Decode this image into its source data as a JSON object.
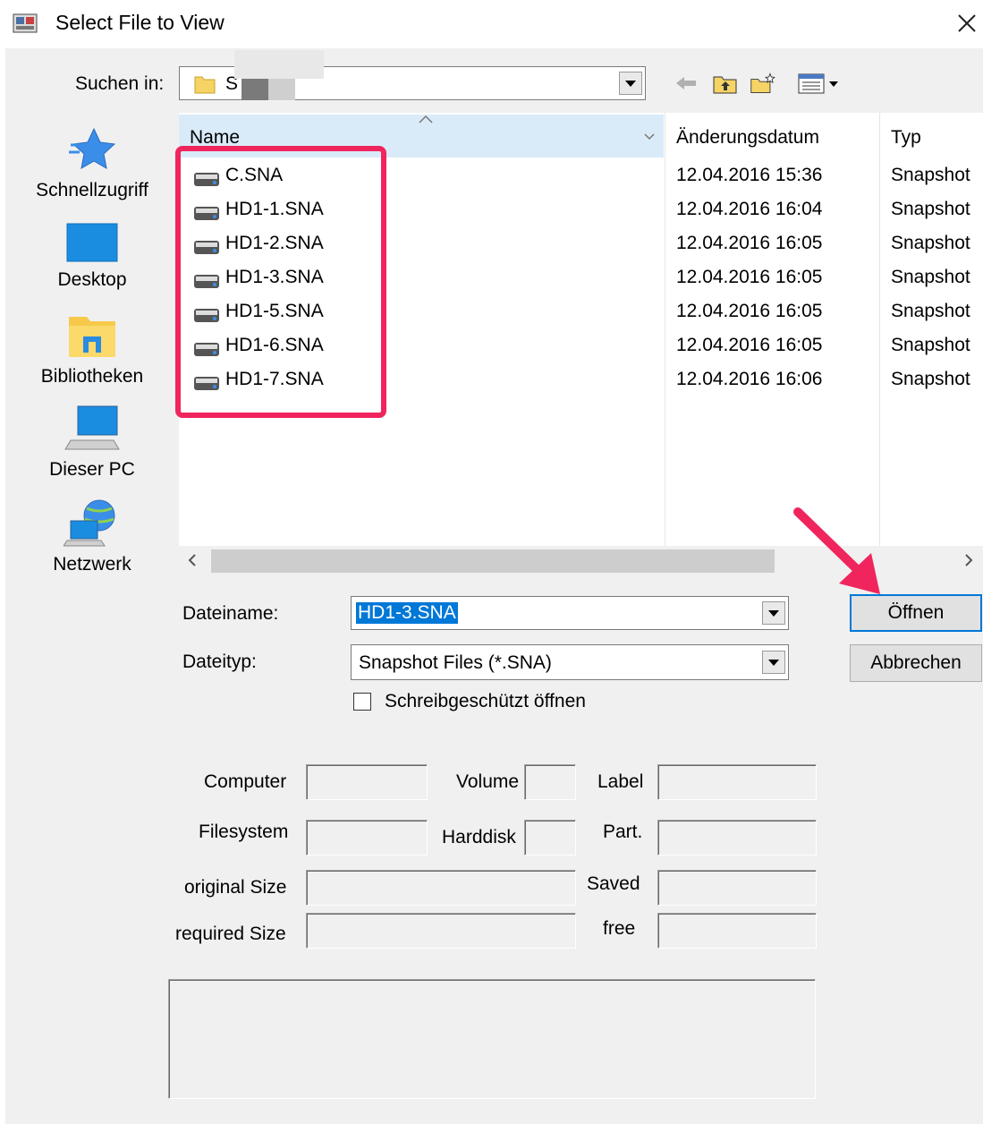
{
  "window": {
    "title": "Select File to View",
    "close_label": "✕"
  },
  "look_in": {
    "label": "Suchen in:",
    "value": "S"
  },
  "places": [
    {
      "label": "Schnellzugriff",
      "icon": "star-icon"
    },
    {
      "label": "Desktop",
      "icon": "desktop-icon"
    },
    {
      "label": "Bibliotheken",
      "icon": "library-icon"
    },
    {
      "label": "Dieser PC",
      "icon": "computer-icon"
    },
    {
      "label": "Netzwerk",
      "icon": "network-icon"
    }
  ],
  "columns": {
    "name": "Name",
    "date": "Änderungsdatum",
    "type": "Typ"
  },
  "files": [
    {
      "name": "C.SNA",
      "date": "12.04.2016 15:36",
      "type": "Snapshot"
    },
    {
      "name": "HD1-1.SNA",
      "date": "12.04.2016 16:04",
      "type": "Snapshot"
    },
    {
      "name": "HD1-2.SNA",
      "date": "12.04.2016 16:05",
      "type": "Snapshot"
    },
    {
      "name": "HD1-3.SNA",
      "date": "12.04.2016 16:05",
      "type": "Snapshot"
    },
    {
      "name": "HD1-5.SNA",
      "date": "12.04.2016 16:05",
      "type": "Snapshot"
    },
    {
      "name": "HD1-6.SNA",
      "date": "12.04.2016 16:05",
      "type": "Snapshot"
    },
    {
      "name": "HD1-7.SNA",
      "date": "12.04.2016 16:06",
      "type": "Snapshot"
    }
  ],
  "filename": {
    "label": "Dateiname:",
    "value": "HD1-3.SNA"
  },
  "filetype": {
    "label": "Dateityp:",
    "value": "Snapshot Files (*.SNA)"
  },
  "readonly": {
    "label": "Schreibgeschützt öffnen",
    "checked": false
  },
  "buttons": {
    "open": "Öffnen",
    "cancel": "Abbrechen"
  },
  "info": {
    "computer": "Computer",
    "volume": "Volume",
    "label": "Label",
    "filesystem": "Filesystem",
    "harddisk": "Harddisk",
    "part": "Part.",
    "original_size": "original Size",
    "saved": "Saved",
    "required_size": "required Size",
    "free": "free"
  },
  "colors": {
    "annotation": "#f0255e",
    "selection": "#0078d7",
    "header_highlight": "#d9ebf9"
  }
}
